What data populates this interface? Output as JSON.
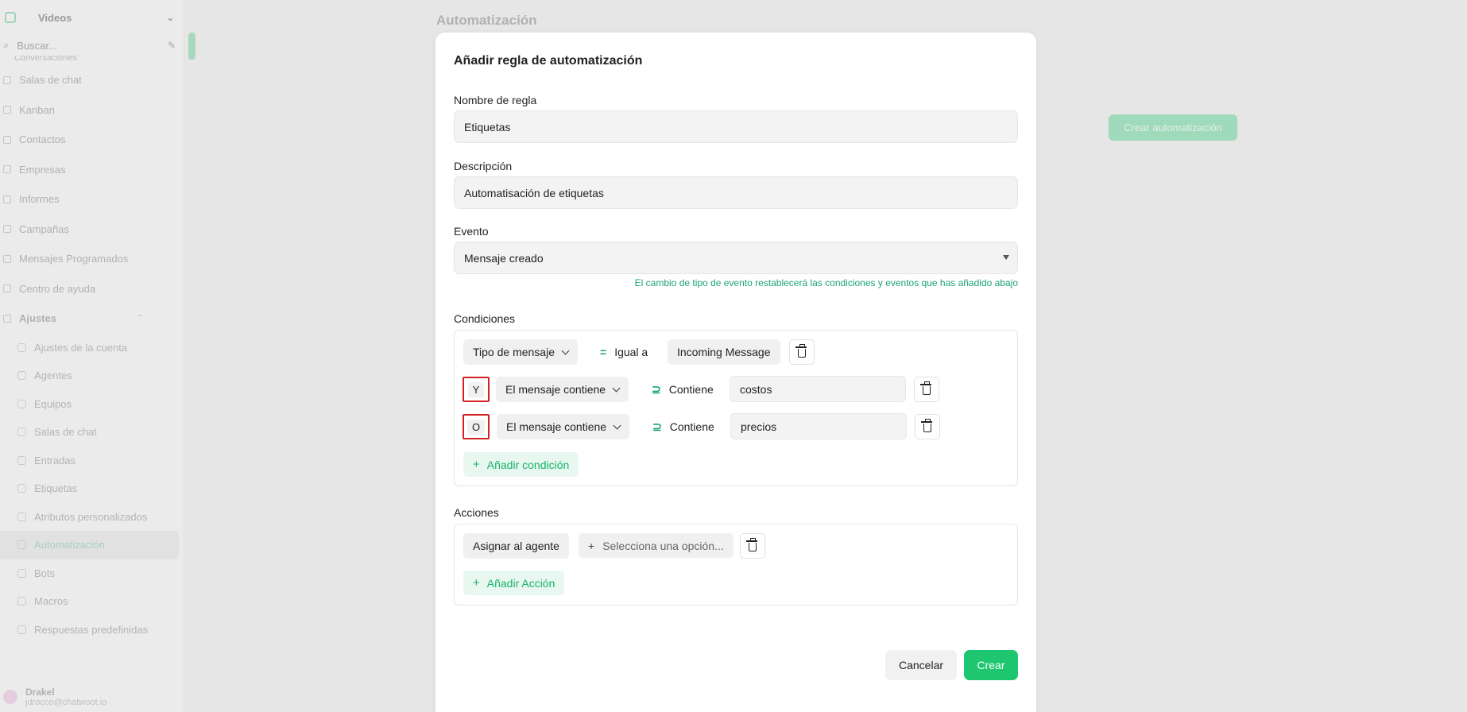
{
  "app": {
    "workspace": "Videos",
    "search_placeholder": "Buscar...",
    "page_title": "Automatización",
    "create_button": "Crear automatización",
    "accent": "#1ec76f"
  },
  "sidebar": {
    "items": [
      {
        "label": "Conversaciones",
        "icon": "chat-icon"
      },
      {
        "label": "Salas de chat",
        "icon": "chat-bubble-icon"
      },
      {
        "label": "Kanban",
        "icon": "kanban-icon"
      },
      {
        "label": "Contactos",
        "icon": "contacts-icon"
      },
      {
        "label": "Empresas",
        "icon": "building-icon"
      },
      {
        "label": "Informes",
        "icon": "report-icon"
      },
      {
        "label": "Campañas",
        "icon": "megaphone-icon"
      },
      {
        "label": "Mensajes Programados",
        "icon": "calendar-icon"
      },
      {
        "label": "Centro de ayuda",
        "icon": "help-icon"
      },
      {
        "label": "Ajustes",
        "icon": "settings-icon"
      }
    ],
    "settings_items": [
      {
        "label": "Ajustes de la cuenta",
        "icon": "account-icon"
      },
      {
        "label": "Agentes",
        "icon": "agents-icon"
      },
      {
        "label": "Equipos",
        "icon": "teams-icon"
      },
      {
        "label": "Salas de chat",
        "icon": "chat-bubble-icon"
      },
      {
        "label": "Entradas",
        "icon": "inbox-icon"
      },
      {
        "label": "Etiquetas",
        "icon": "tag-icon"
      },
      {
        "label": "Atributos personalizados",
        "icon": "code-icon"
      },
      {
        "label": "Automatización",
        "icon": "automation-icon"
      },
      {
        "label": "Bots",
        "icon": "bot-icon"
      },
      {
        "label": "Macros",
        "icon": "macro-icon"
      },
      {
        "label": "Respuestas predefinidas",
        "icon": "reply-icon"
      }
    ],
    "user": {
      "name": "Drakel",
      "email": "jdrocco@chatwoot.io"
    }
  },
  "modal": {
    "title": "Añadir regla de automatización",
    "rule_name_label": "Nombre de regla",
    "rule_name_value": "Etiquetas",
    "description_label": "Descripción",
    "description_value": "Automatisación de etiquetas",
    "event_label": "Evento",
    "event_value": "Mensaje creado",
    "event_hint": "El cambio de tipo de evento restablecerá las condiciones y eventos que has añadido abajo",
    "conditions_label": "Condiciones",
    "conditions": [
      {
        "field": "Tipo de mensaje",
        "operator": "Igual a",
        "operator_symbol": "=",
        "value": "Incoming Message"
      },
      {
        "logic": "Y",
        "field": "El mensaje contiene",
        "operator": "Contiene",
        "operator_symbol": "⊇",
        "value": "costos"
      },
      {
        "logic": "O",
        "field": "El mensaje contiene",
        "operator": "Contiene",
        "operator_symbol": "⊇",
        "value": "precios"
      }
    ],
    "add_condition": "Añadir condición",
    "actions_label": "Acciones",
    "action": {
      "type": "Asignar al agente",
      "placeholder": "Selecciona una opción..."
    },
    "add_action": "Añadir Acción",
    "cancel": "Cancelar",
    "create": "Crear"
  }
}
